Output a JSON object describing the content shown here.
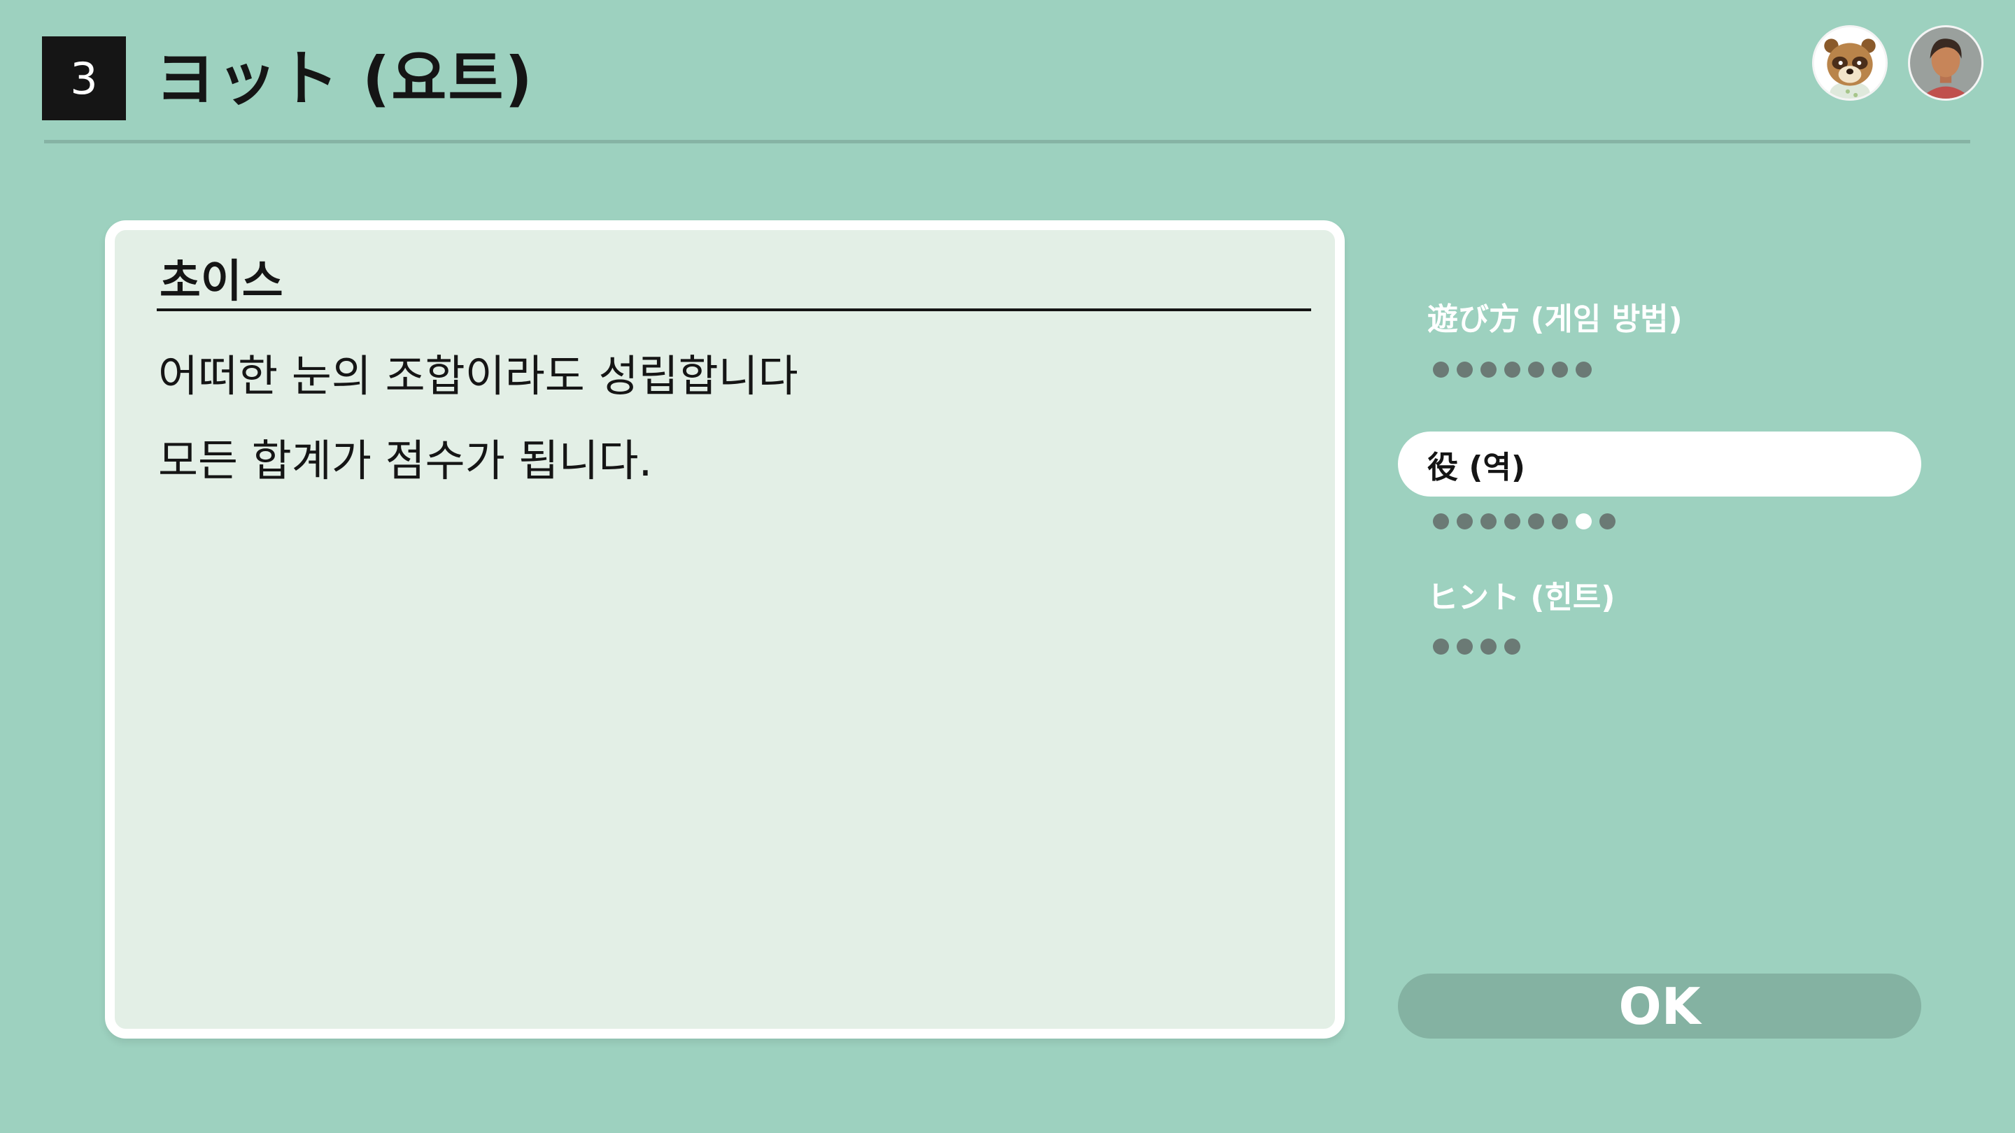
{
  "header": {
    "number": "3",
    "title": "ヨット (요트)"
  },
  "avatars": [
    {
      "name": "raccoon-character"
    },
    {
      "name": "player-character"
    }
  ],
  "content": {
    "heading": "초이스",
    "lines": [
      "어떠한 눈의 조합이라도 성립합니다",
      "모든 합계가 점수가 됩니다."
    ]
  },
  "menu": {
    "items": [
      {
        "label": "遊び方 (게임 방법)",
        "page_count": 7,
        "current_page": null,
        "selected": false
      },
      {
        "label": "役 (역)",
        "page_count": 8,
        "current_page": 7,
        "selected": true
      },
      {
        "label": "ヒント (힌트)",
        "page_count": 4,
        "current_page": null,
        "selected": false
      }
    ]
  },
  "ok_button": {
    "label": "OK"
  },
  "colors": {
    "background": "#9dd1bf",
    "panel": "#e3efe6",
    "ok_button": "#84b2a2",
    "dot": "#6b7a75"
  }
}
